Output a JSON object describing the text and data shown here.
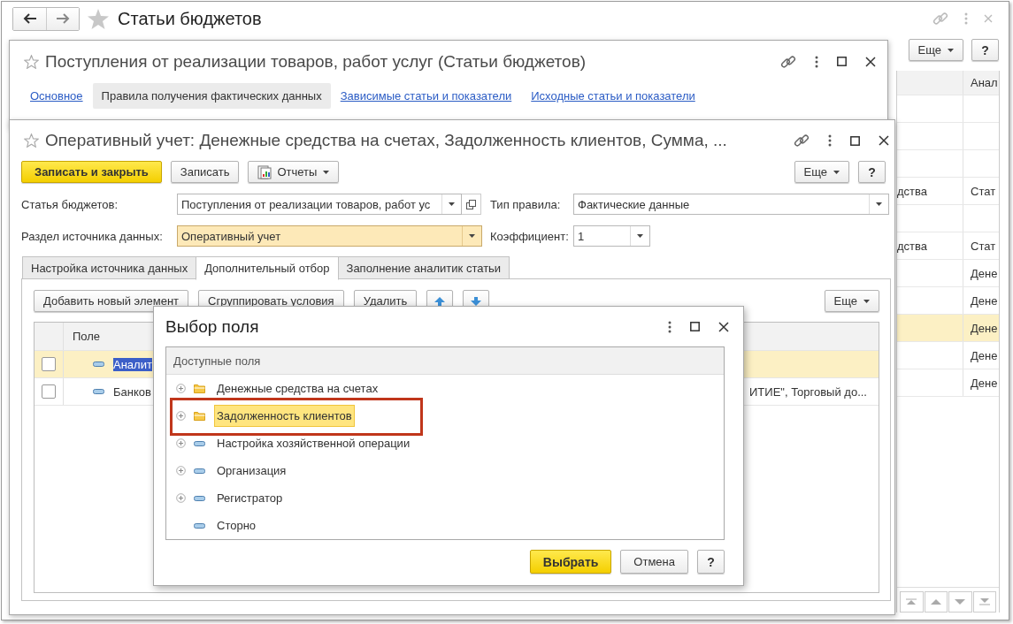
{
  "main_window": {
    "title": "Статьи бюджетов",
    "toolbar_buttons": [
      {
        "label": "Еще",
        "kind": "menu"
      },
      {
        "label": "?",
        "kind": "plain"
      }
    ],
    "list": {
      "header": {
        "column_2": "Анал"
      },
      "rows": [
        {
          "selected": false
        },
        {
          "selected": false
        },
        {
          "selected": false
        },
        {
          "column_1": "дства",
          "column_2": "Стат",
          "selected": false
        },
        {
          "selected": false
        },
        {
          "column_1": "дства",
          "column_2": "Стат",
          "selected": false
        },
        {
          "column_2": "Дене",
          "selected": false
        },
        {
          "column_2": "Дене",
          "selected": false
        },
        {
          "column_2": "Дене",
          "selected": true
        },
        {
          "column_2": "Дене",
          "selected": false
        },
        {
          "column_2": "Дене",
          "selected": false
        }
      ]
    }
  },
  "item_window": {
    "title": "Поступления от реализации товаров, работ услуг (Статьи бюджетов)",
    "sections": [
      {
        "label": "Основное",
        "selected": false
      },
      {
        "label": "Правила получения фактических данных",
        "selected": true
      },
      {
        "label": "Зависимые статьи и показатели",
        "selected": false
      },
      {
        "label": "Исходные статьи и показатели",
        "selected": false
      }
    ]
  },
  "rule_window": {
    "title": "Оперативный учет: Денежные средства на счетах, Задолженность клиентов, Сумма, ...",
    "buttons": [
      {
        "label": "Записать и закрыть",
        "kind": "default"
      },
      {
        "label": "Записать",
        "kind": "plain"
      },
      {
        "label": "Отчеты",
        "kind": "report-menu"
      }
    ],
    "right_buttons": [
      {
        "label": "Еще",
        "kind": "menu"
      },
      {
        "label": "?",
        "kind": "plain"
      }
    ],
    "fields": [
      {
        "label": "Статья бюджетов:",
        "value": "Поступления от реализации товаров, работ ус",
        "kind": "select-open",
        "focused": false
      },
      {
        "label": "Тип правила:",
        "value": "Фактические данные",
        "kind": "select",
        "focused": false
      },
      {
        "label": "Раздел источника данных:",
        "value": "Оперативный учет",
        "kind": "select",
        "focused": true
      },
      {
        "label": "Коэффициент:",
        "value": "1",
        "kind": "select",
        "focused": false
      }
    ],
    "tabs": [
      {
        "label": "Настройка источника данных",
        "selected": false
      },
      {
        "label": "Дополнительный отбор",
        "selected": true
      },
      {
        "label": "Заполнение аналитик статьи",
        "selected": false
      }
    ],
    "filter_toolbar": [
      {
        "label": "Добавить новый элемент",
        "kind": "text"
      },
      {
        "label": "Сгруппировать условия",
        "kind": "text"
      },
      {
        "label": "Удалить",
        "kind": "text"
      },
      {
        "kind": "up"
      },
      {
        "kind": "down"
      }
    ],
    "filter_more": {
      "label": "Еще"
    },
    "filter_table": {
      "columns": [
        "Поле"
      ],
      "rows": [
        {
          "checked": false,
          "selected": true,
          "field": "Аналит"
        },
        {
          "checked": false,
          "selected": false,
          "field": "Банков",
          "column_3": "ИТИЕ\", Торговый до..."
        }
      ]
    }
  },
  "dialog": {
    "title": "Выбор поля",
    "tree_header": "Доступные поля",
    "items": [
      {
        "label": "Денежные средства на счетах",
        "kind": "folder",
        "expandable": true,
        "selected": false,
        "highlighted": false
      },
      {
        "label": "Задолженность клиентов",
        "kind": "folder",
        "expandable": true,
        "selected": true,
        "highlighted": true
      },
      {
        "label": "Настройка хозяйственной операции",
        "kind": "field",
        "expandable": true,
        "selected": false,
        "highlighted": false
      },
      {
        "label": "Организация",
        "kind": "field",
        "expandable": true,
        "selected": false,
        "highlighted": false
      },
      {
        "label": "Регистратор",
        "kind": "field",
        "expandable": true,
        "selected": false,
        "highlighted": false
      },
      {
        "label": "Сторно",
        "kind": "field",
        "expandable": false,
        "selected": false,
        "highlighted": false
      }
    ],
    "buttons": [
      {
        "label": "Выбрать",
        "kind": "default"
      },
      {
        "label": "Отмена",
        "kind": "plain"
      },
      {
        "label": "?",
        "kind": "plain"
      }
    ]
  }
}
